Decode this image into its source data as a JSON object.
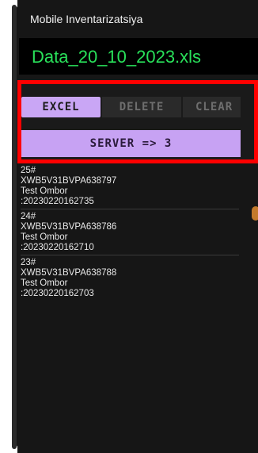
{
  "app": {
    "title": "Mobile Inventarizatsiya"
  },
  "file": {
    "name": "Data_20_10_2023.xls"
  },
  "actions": {
    "excel_label": "EXCEL",
    "delete_label": "DELETE",
    "clear_label": "CLEAR",
    "server_label": "SERVER => 3"
  },
  "records": [
    {
      "index": "25#",
      "code": "XWB5V31BVPA638797",
      "location": "Test Ombor",
      "timestamp": ":20230220162735"
    },
    {
      "index": "24#",
      "code": "XWB5V31BVPA638786",
      "location": "Test Ombor",
      "timestamp": ":20230220162710"
    },
    {
      "index": "23#",
      "code": "XWB5V31BVPA638788",
      "location": "Test Ombor",
      "timestamp": ":20230220162703"
    }
  ],
  "colors": {
    "background": "#161616",
    "file_name": "#29e05a",
    "highlight_border": "#ff0000",
    "button_active": "#c9a6f5",
    "button_inactive": "#2a2a2a"
  }
}
